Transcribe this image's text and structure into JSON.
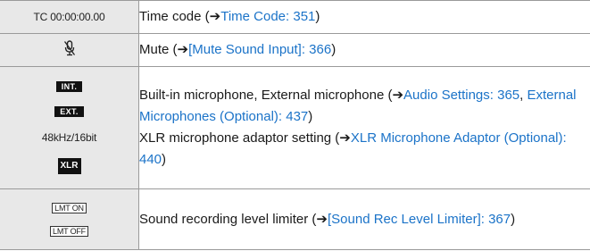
{
  "rows": [
    {
      "icon_text": "TC 00:00:00.00",
      "description": "Time code (",
      "arrow": "➔",
      "link": "Time Code: 351",
      "close": ")"
    },
    {
      "icon_name": "mute-microphone-icon",
      "description": "Mute (",
      "arrow": "➔",
      "link": "[Mute Sound Input]: 366",
      "close": ")"
    },
    {
      "icons": {
        "int": "INT.",
        "ext": "EXT.",
        "sample_rate": "48kHz/16bit",
        "xlr": "XLR"
      },
      "line1": "Built-in microphone, External microphone (",
      "arrow1": "➔",
      "link1": "Audio Settings: 365",
      "sep": ", ",
      "link2": "External Microphones (Optional): 437",
      "close1": ")",
      "line2": "XLR microphone adaptor setting (",
      "arrow2": "➔",
      "link3": "XLR Microphone Adaptor (Optional): 440",
      "close2": ")"
    },
    {
      "icons": {
        "lmt_on": "LMT ON",
        "lmt_off": "LMT OFF"
      },
      "description": "Sound recording level limiter (",
      "arrow": "➔",
      "link": "[Sound Rec Level Limiter]: 367",
      "close": ")"
    }
  ]
}
